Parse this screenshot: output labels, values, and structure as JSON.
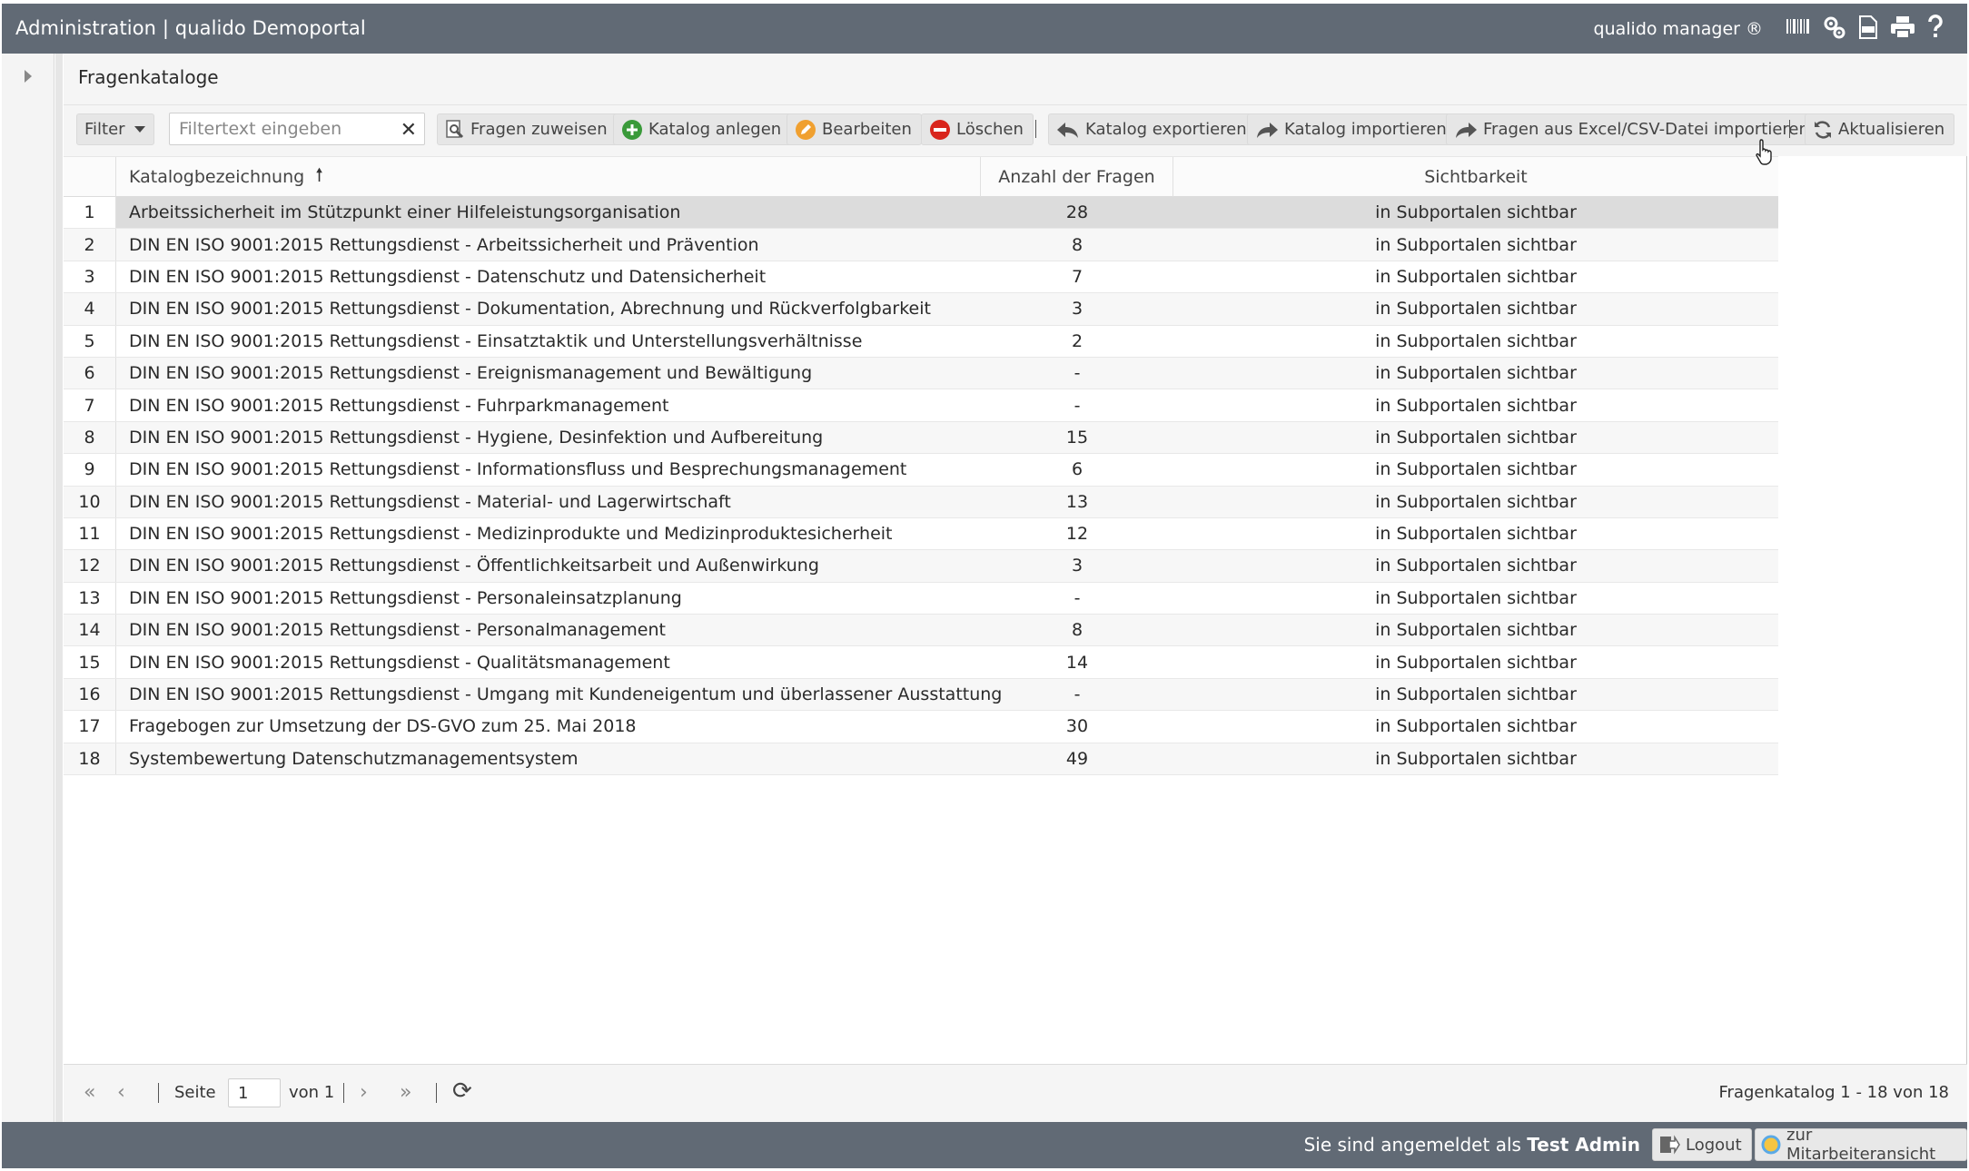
{
  "window": {
    "title": "Administration | qualido Demoportal",
    "product": "qualido manager ®",
    "icons": [
      "barcode-icon",
      "gears-icon",
      "xls-file-icon",
      "print-icon",
      "help-icon"
    ]
  },
  "panel": {
    "title": "Fragenkataloge"
  },
  "toolbar": {
    "filter_label": "Filter",
    "filter_placeholder": "Filtertext eingeben",
    "clear_glyph": "✕",
    "buttons": {
      "assign": "Fragen zuweisen",
      "create": "Katalog anlegen",
      "edit": "Bearbeiten",
      "delete": "Löschen",
      "export": "Katalog exportieren",
      "import": "Katalog importieren",
      "import_excel": "Fragen aus Excel/CSV-Datei importieren",
      "refresh": "Aktualisieren"
    }
  },
  "grid": {
    "columns": {
      "name": "Katalogbezeichnung",
      "count": "Anzahl der Fragen",
      "visibility": "Sichtbarkeit"
    },
    "sort_glyph": "🠕",
    "selected_row": 1,
    "rows": [
      {
        "num": "1",
        "name": "Arbeitssicherheit im Stützpunkt einer Hilfeleistungsorganisation",
        "count": "28",
        "visibility": "in Subportalen sichtbar"
      },
      {
        "num": "2",
        "name": "DIN EN ISO 9001:2015 Rettungsdienst - Arbeitssicherheit und Prävention",
        "count": "8",
        "visibility": "in Subportalen sichtbar"
      },
      {
        "num": "3",
        "name": "DIN EN ISO 9001:2015 Rettungsdienst - Datenschutz und Datensicherheit",
        "count": "7",
        "visibility": "in Subportalen sichtbar"
      },
      {
        "num": "4",
        "name": "DIN EN ISO 9001:2015 Rettungsdienst - Dokumentation, Abrechnung und Rückverfolgbarkeit",
        "count": "3",
        "visibility": "in Subportalen sichtbar"
      },
      {
        "num": "5",
        "name": "DIN EN ISO 9001:2015 Rettungsdienst - Einsatztaktik und Unterstellungsverhältnisse",
        "count": "2",
        "visibility": "in Subportalen sichtbar"
      },
      {
        "num": "6",
        "name": "DIN EN ISO 9001:2015 Rettungsdienst - Ereignismanagement und Bewältigung",
        "count": "-",
        "visibility": "in Subportalen sichtbar"
      },
      {
        "num": "7",
        "name": "DIN EN ISO 9001:2015 Rettungsdienst - Fuhrparkmanagement",
        "count": "-",
        "visibility": "in Subportalen sichtbar"
      },
      {
        "num": "8",
        "name": "DIN EN ISO 9001:2015 Rettungsdienst - Hygiene, Desinfektion und Aufbereitung",
        "count": "15",
        "visibility": "in Subportalen sichtbar"
      },
      {
        "num": "9",
        "name": "DIN EN ISO 9001:2015 Rettungsdienst - Informationsfluss und Besprechungsmanagement",
        "count": "6",
        "visibility": "in Subportalen sichtbar"
      },
      {
        "num": "10",
        "name": "DIN EN ISO 9001:2015 Rettungsdienst - Material- und Lagerwirtschaft",
        "count": "13",
        "visibility": "in Subportalen sichtbar"
      },
      {
        "num": "11",
        "name": "DIN EN ISO 9001:2015 Rettungsdienst - Medizinprodukte und Medizinproduktesicherheit",
        "count": "12",
        "visibility": "in Subportalen sichtbar"
      },
      {
        "num": "12",
        "name": "DIN EN ISO 9001:2015 Rettungsdienst - Öffentlichkeitsarbeit und Außenwirkung",
        "count": "3",
        "visibility": "in Subportalen sichtbar"
      },
      {
        "num": "13",
        "name": "DIN EN ISO 9001:2015 Rettungsdienst - Personaleinsatzplanung",
        "count": "-",
        "visibility": "in Subportalen sichtbar"
      },
      {
        "num": "14",
        "name": "DIN EN ISO 9001:2015 Rettungsdienst - Personalmanagement",
        "count": "8",
        "visibility": "in Subportalen sichtbar"
      },
      {
        "num": "15",
        "name": "DIN EN ISO 9001:2015 Rettungsdienst - Qualitätsmanagement",
        "count": "14",
        "visibility": "in Subportalen sichtbar"
      },
      {
        "num": "16",
        "name": "DIN EN ISO 9001:2015 Rettungsdienst - Umgang mit Kundeneigentum und überlassener Ausstattung",
        "count": "-",
        "visibility": "in Subportalen sichtbar"
      },
      {
        "num": "17",
        "name": "Fragebogen zur Umsetzung der DS-GVO zum 25. Mai 2018",
        "count": "30",
        "visibility": "in Subportalen sichtbar"
      },
      {
        "num": "18",
        "name": "Systembewertung Datenschutzmanagementsystem",
        "count": "49",
        "visibility": "in Subportalen sichtbar"
      }
    ]
  },
  "pager": {
    "first": "«",
    "prev": "‹",
    "page_label": "Seite",
    "page_value": "1",
    "of_label": "von 1",
    "next": "›",
    "last": "»",
    "refresh": "⟳",
    "info": "Fragenkatalog 1 - 18 von 18"
  },
  "footer": {
    "login_prefix": "Sie sind angemeldet als",
    "user": "Test Admin",
    "logout": "Logout",
    "employee_view": "zur Mitarbeiteransicht"
  },
  "colors": {
    "header_bg": "#616a75",
    "toolbar_bg": "#f5f5f5",
    "selected_row": "#dcdcdc",
    "create_green": "#3a9a3a",
    "delete_red": "#d9251c",
    "edit_orange": "#f0a030"
  }
}
